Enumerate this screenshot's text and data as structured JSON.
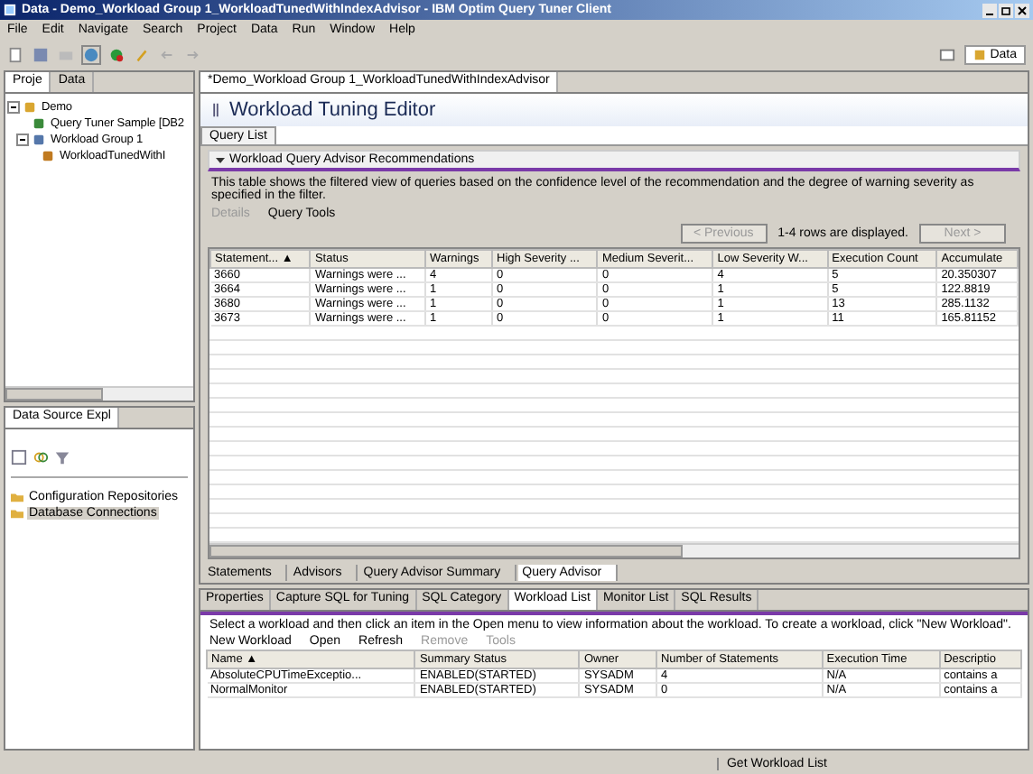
{
  "window": {
    "title": "Data - Demo_Workload Group 1_WorkloadTunedWithIndexAdvisor - IBM Optim Query Tuner Client"
  },
  "menu": [
    "File",
    "Edit",
    "Navigate",
    "Search",
    "Project",
    "Data",
    "Run",
    "Window",
    "Help"
  ],
  "perspective": {
    "label": "Data",
    "selected": true
  },
  "project_explorer": {
    "tabs": [
      {
        "label": "Proje",
        "selected": true
      },
      {
        "label": "Data",
        "selected": false
      }
    ],
    "tree": [
      {
        "label": "Demo",
        "kind": "project",
        "expanded": true,
        "children": [
          {
            "label": "Query Tuner Sample [DB2",
            "kind": "connection"
          },
          {
            "label": "Workload Group 1",
            "kind": "group",
            "expanded": true,
            "children": [
              {
                "label": "WorkloadTunedWithI",
                "kind": "file"
              }
            ]
          }
        ]
      }
    ]
  },
  "data_source_explorer": {
    "title": "Data Source Expl",
    "tree": [
      {
        "label": "Configuration Repositories",
        "selected": false
      },
      {
        "label": "Database Connections",
        "selected": true
      }
    ]
  },
  "editor": {
    "tab": "*Demo_Workload Group 1_WorkloadTunedWithIndexAdvisor",
    "title": "Workload Tuning Editor",
    "subtabs": [
      {
        "label": "Query List",
        "selected": true
      }
    ],
    "section": "Workload Query Advisor Recommendations",
    "description": "This table shows the filtered view of queries based on the confidence level of the recommendation and the degree of warning severity as specified in the filter.",
    "actions": [
      {
        "label": "Details",
        "disabled": true
      },
      {
        "label": "Query Tools",
        "disabled": false
      }
    ],
    "pagination": {
      "previous": {
        "label": "< Previous",
        "disabled": true
      },
      "info": "1-4 rows are displayed.",
      "next": {
        "label": "Next >",
        "disabled": true
      }
    },
    "table": {
      "columns": [
        "Statement... ▲",
        "Status",
        "Warnings",
        "High Severity ...",
        "Medium Severit...",
        "Low Severity W...",
        "Execution Count",
        "Accumulate"
      ],
      "rows": [
        [
          "3660",
          "Warnings were ...",
          "4",
          "0",
          "0",
          "4",
          "5",
          "20.350307"
        ],
        [
          "3664",
          "Warnings were ...",
          "1",
          "0",
          "0",
          "1",
          "5",
          "122.8819"
        ],
        [
          "3680",
          "Warnings were ...",
          "1",
          "0",
          "0",
          "1",
          "13",
          "285.1132"
        ],
        [
          "3673",
          "Warnings were ...",
          "1",
          "0",
          "0",
          "1",
          "11",
          "165.81152"
        ]
      ]
    },
    "bottom_tabs": [
      {
        "label": "Statements",
        "selected": false
      },
      {
        "label": "Advisors",
        "selected": false
      },
      {
        "label": "Query Advisor Summary",
        "selected": false
      },
      {
        "label": "Query Advisor",
        "selected": true
      }
    ]
  },
  "views": {
    "tabs": [
      {
        "label": "Properties",
        "selected": false
      },
      {
        "label": "Capture SQL for Tuning",
        "selected": false
      },
      {
        "label": "SQL Category",
        "selected": false
      },
      {
        "label": "Workload List",
        "selected": true
      },
      {
        "label": "Monitor List",
        "selected": false
      },
      {
        "label": "SQL Results",
        "selected": false
      }
    ],
    "description": "Select a workload and then click an item in the Open menu to view information about the workload.  To create a workload, click \"New Workload\".",
    "actions": [
      {
        "label": "New Workload",
        "disabled": false
      },
      {
        "label": "Open",
        "disabled": false
      },
      {
        "label": "Refresh",
        "disabled": false
      },
      {
        "label": "Remove",
        "disabled": true
      },
      {
        "label": "Tools",
        "disabled": true
      }
    ],
    "table": {
      "columns": [
        "Name ▲",
        "Summary Status",
        "Owner",
        "Number of Statements",
        "Execution Time",
        "Descriptio"
      ],
      "rows": [
        [
          "AbsoluteCPUTimeExceptio...",
          "ENABLED(STARTED)",
          "SYSADM",
          "4",
          "N/A",
          "contains a"
        ],
        [
          "NormalMonitor",
          "ENABLED(STARTED)",
          "SYSADM",
          "0",
          "N/A",
          "contains a"
        ]
      ]
    }
  },
  "status_bar": {
    "message": "Get Workload List"
  }
}
